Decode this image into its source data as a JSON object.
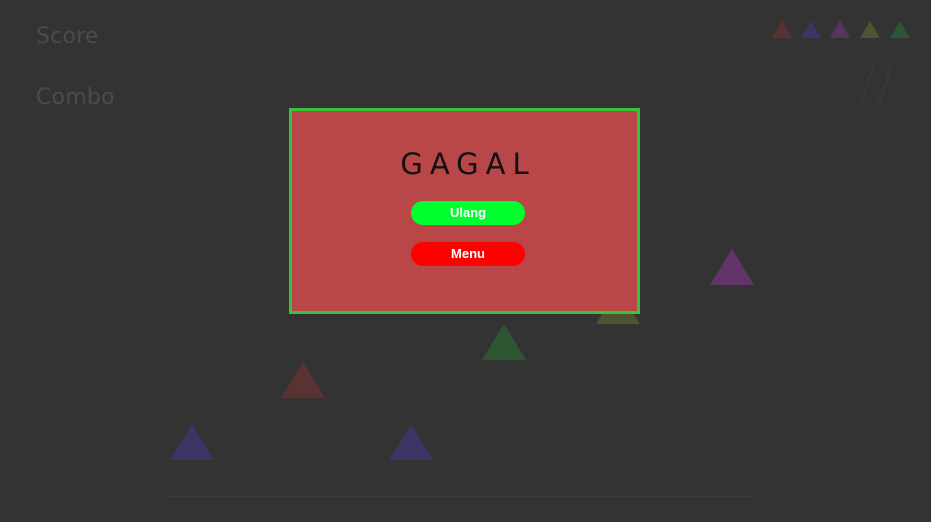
{
  "hud": {
    "score_label": "Score",
    "combo_label": "Combo"
  },
  "legend_triangles": [
    {
      "color": "#5a3232",
      "icon": "triangle-icon"
    },
    {
      "color": "#3b3563",
      "icon": "triangle-icon"
    },
    {
      "color": "#5a3460",
      "icon": "triangle-icon"
    },
    {
      "color": "#4e5331",
      "icon": "triangle-icon"
    },
    {
      "color": "#2e5532",
      "icon": "triangle-icon"
    }
  ],
  "falling_triangles": [
    {
      "color": "#63346a",
      "icon": "triangle-icon"
    },
    {
      "color": "#2e5532",
      "icon": "triangle-icon"
    },
    {
      "color": "#5a3232",
      "icon": "triangle-icon"
    },
    {
      "color": "#3b3563",
      "icon": "triangle-icon"
    },
    {
      "color": "#3b3563",
      "icon": "triangle-icon"
    },
    {
      "color": "#4e5331",
      "icon": "triangle-icon"
    }
  ],
  "dialog": {
    "title": "GAGAL",
    "retry_label": "Ulang",
    "menu_label": "Menu",
    "background": "#b94747",
    "border": "#37c437",
    "retry_color": "#00ff2e",
    "menu_color": "#ff0000"
  }
}
